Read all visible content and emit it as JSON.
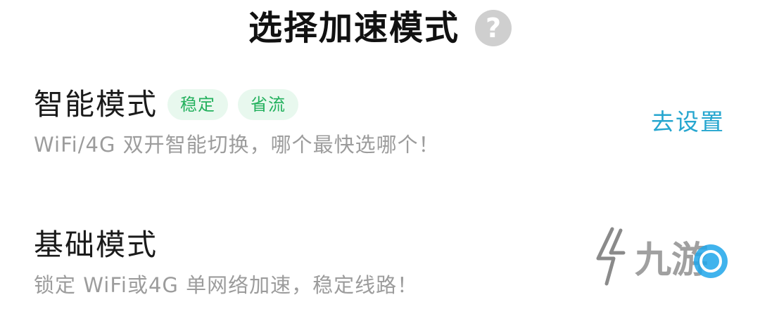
{
  "header": {
    "title": "选择加速模式",
    "help_icon": "question-circle-icon",
    "help_glyph": "?"
  },
  "modes": [
    {
      "title": "智能模式",
      "tags": [
        "稳定",
        "省流"
      ],
      "description": "WiFi/4G 双开智能切换，哪个最快选哪个！",
      "action_label": "去设置"
    },
    {
      "title": "基础模式",
      "description": "锁定 WiFi或4G 单网络加速，稳定线路！"
    }
  ],
  "watermark": {
    "text": "九游"
  },
  "colors": {
    "tag_bg": "#e8f8ee",
    "tag_text": "#24b15e",
    "link": "#26a6cf",
    "secondary_text": "#9c9c9c",
    "help_icon_bg": "#cfcfcf"
  }
}
